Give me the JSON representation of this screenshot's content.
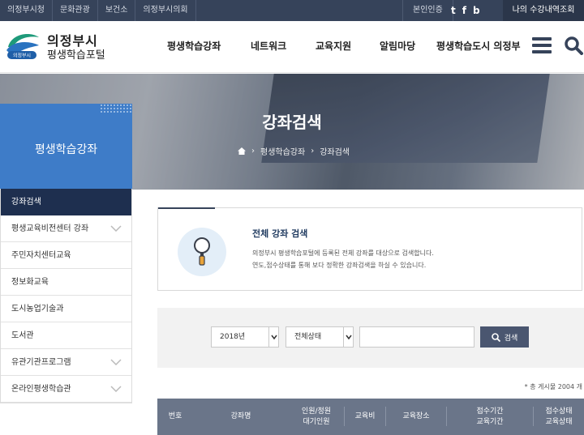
{
  "topbar": {
    "links": [
      "의정부시청",
      "문화관광",
      "보건소",
      "의정부시의회"
    ],
    "auth_label": "본인인증",
    "sns": [
      {
        "icon": "twitter-icon",
        "glyph": "t"
      },
      {
        "icon": "facebook-icon",
        "glyph": "f"
      },
      {
        "icon": "blog-icon",
        "glyph": "b"
      }
    ],
    "my_course_label": "나의 수강내역조회"
  },
  "header": {
    "logo_badge_text": "의정부시",
    "logo_title": "의정부시",
    "logo_subtitle": "평생학습포털",
    "nav": [
      "평생학습강좌",
      "네트워크",
      "교육지원",
      "알림마당",
      "평생학습도시 의정부"
    ]
  },
  "banner": {
    "title": "강좌검색",
    "breadcrumb": [
      "평생학습강좌",
      "강좌검색"
    ]
  },
  "sidebar": {
    "title": "평생학습강좌",
    "items": [
      {
        "label": "강좌검색",
        "active": true,
        "has_sub": false
      },
      {
        "label": "평생교육비전센터 강좌",
        "active": false,
        "has_sub": true
      },
      {
        "label": "주민자치센터교육",
        "active": false,
        "has_sub": false
      },
      {
        "label": "정보화교육",
        "active": false,
        "has_sub": false
      },
      {
        "label": "도시농업기술과",
        "active": false,
        "has_sub": false
      },
      {
        "label": "도서관",
        "active": false,
        "has_sub": false
      },
      {
        "label": "유관기관프로그램",
        "active": false,
        "has_sub": true
      },
      {
        "label": "온라인평생학습관",
        "active": false,
        "has_sub": true
      }
    ]
  },
  "intro": {
    "title": "전체 강좌 검색",
    "line1": "의정부시 평생학습포털에 등록된 전체 강좌를 대상으로 검색합니다.",
    "line2": "연도,접수상태를 통해 보다 정확한 강좌검색을 하실 수 있습니다."
  },
  "search": {
    "year_value": "2018년",
    "status_value": "전체상태",
    "keyword_value": "",
    "button_label": "검색"
  },
  "total_text": "* 총 게시물 2004 개",
  "table": {
    "headers": [
      [
        "번호"
      ],
      [
        "강좌명"
      ],
      [
        "인원/정원",
        "대기인원"
      ],
      [
        "교육비"
      ],
      [
        "교육장소"
      ],
      [
        "접수기간",
        "교육기간"
      ],
      [
        "접수상태",
        "교육상태"
      ]
    ]
  },
  "colors": {
    "topbar": "#36435a",
    "sidebar_head": "#3e7cc8",
    "sidebar_active": "#1e2f4f",
    "search_button": "#4a5670",
    "table_header": "#6a7589"
  }
}
